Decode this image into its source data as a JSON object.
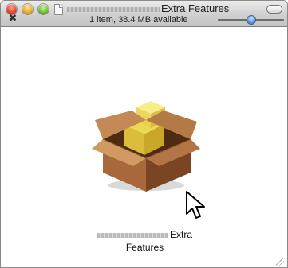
{
  "window": {
    "title": "Extra Features",
    "status_text": "1 item, 38.4 MB available",
    "icon_size_level": 0.5
  },
  "items": [
    {
      "label_line1": "Extra",
      "label_line2": "Features",
      "icon": "package-box-icon"
    }
  ],
  "colors": {
    "close": "#e0442e",
    "minimize": "#e7a82c",
    "zoom": "#6fbb33",
    "slider_accent": "#4b86d6"
  }
}
